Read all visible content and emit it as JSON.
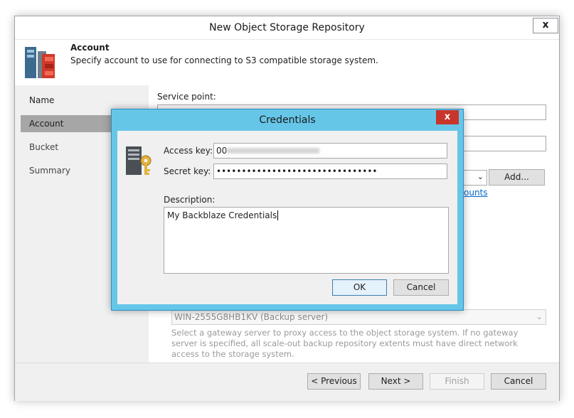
{
  "wizard": {
    "title": "New Object Storage Repository",
    "close_label": "x",
    "header": {
      "title": "Account",
      "subtitle": "Specify account to use for connecting to S3 compatible storage system."
    },
    "steps": [
      {
        "label": "Name"
      },
      {
        "label": "Account"
      },
      {
        "label": "Bucket"
      },
      {
        "label": "Summary"
      }
    ],
    "content": {
      "service_point_label": "Service point:",
      "add_button": "Add...",
      "manage_link": "ounts",
      "gateway_value": "WIN-2555G8HB1KV (Backup server)",
      "gateway_help": "Select a gateway server to proxy access to the object storage system. If no gateway server is specified, all scale-out backup repository extents must have direct network access to the storage system."
    },
    "footer": {
      "previous": "< Previous",
      "next": "Next >",
      "finish": "Finish",
      "cancel": "Cancel"
    }
  },
  "credentials_dialog": {
    "title": "Credentials",
    "close_label": "x",
    "access_key_label": "Access key:",
    "access_key_value": "00",
    "secret_key_label": "Secret key:",
    "secret_key_value": "••••••••••••••••••••••••••••••••",
    "description_label": "Description:",
    "description_value": "My Backblaze Credentials",
    "ok_button": "OK",
    "cancel_button": "Cancel"
  },
  "colors": {
    "dialog_frame": "#66c6e8",
    "close_red": "#c8352b",
    "sidebar_active": "#a6a6a6",
    "link": "#0066cc"
  }
}
